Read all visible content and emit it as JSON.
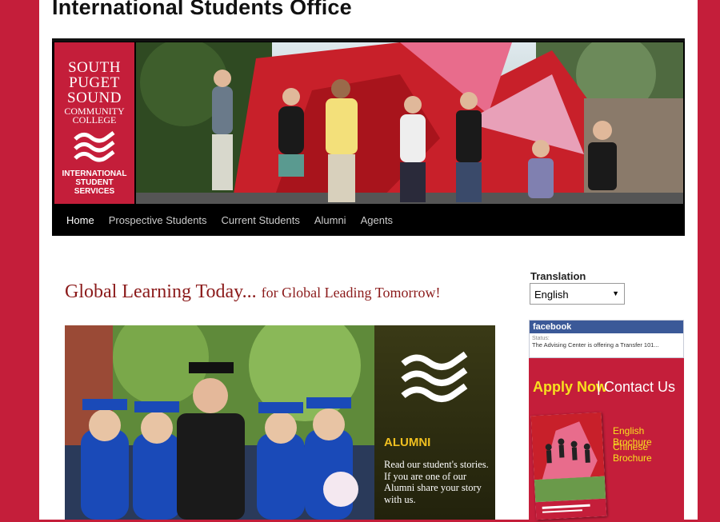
{
  "site": {
    "title": "International Students Office"
  },
  "logo": {
    "line1": "SOUTH PUGET SOUND",
    "line2": "COMMUNITY COLLEGE",
    "line3": "INTERNATIONAL STUDENT SERVICES"
  },
  "nav": {
    "items": [
      {
        "label": "Home",
        "active": true
      },
      {
        "label": "Prospective Students",
        "active": false
      },
      {
        "label": "Current Students",
        "active": false
      },
      {
        "label": "Alumni",
        "active": false
      },
      {
        "label": "Agents",
        "active": false
      }
    ]
  },
  "main": {
    "tagline_big": "Global Learning Today...",
    "tagline_small": "for Global Leading Tomorrow!",
    "feature": {
      "heading": "ALUMNI",
      "text": "Read our student's stories. If you are one of our Alumni share your story with us."
    }
  },
  "sidebar": {
    "translation_label": "Translation",
    "language_selected": "English",
    "facebook": {
      "brand": "facebook",
      "status_label": "Status:",
      "status_text": "The Advising Center is offering a Transfer 101..."
    },
    "apply_now": "Apply Now",
    "separator": "|",
    "contact_us": "Contact Us",
    "english_brochure": "English Brochure",
    "chinese_brochure": "Chinese Brochure"
  },
  "colors": {
    "brand_red": "#c41e3a",
    "accent_yellow": "#f7e11f",
    "tagline_red": "#8b1a1a",
    "facebook_blue": "#3b5998"
  }
}
